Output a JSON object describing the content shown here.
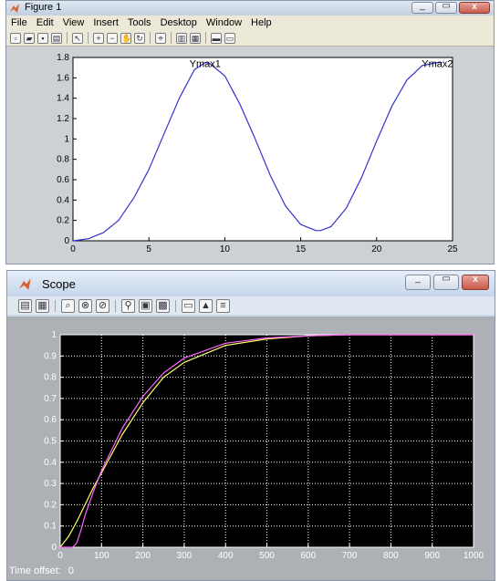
{
  "figure_window": {
    "title": "Figure 1",
    "menu": [
      "File",
      "Edit",
      "View",
      "Insert",
      "Tools",
      "Desktop",
      "Window",
      "Help"
    ],
    "toolbar_icons": [
      "new-file-icon",
      "open-icon",
      "save-icon",
      "print-icon",
      "pointer-icon",
      "zoom-in-icon",
      "zoom-out-icon",
      "pan-icon",
      "rotate-icon",
      "data-cursor-icon",
      "colorbar-icon",
      "legend-icon",
      "hide-tools-icon",
      "show-tools-icon"
    ]
  },
  "scope_window": {
    "title": "Scope",
    "toolbar_icons": [
      "print-icon",
      "parameters-icon",
      "zoom-icon",
      "zoom-x-icon",
      "zoom-y-icon",
      "autoscale-icon",
      "save-axes-icon",
      "restore-axes-icon",
      "floating-scope-icon",
      "lock-axes-icon",
      "signal-selector-icon"
    ],
    "time_offset_label": "Time offset:",
    "time_offset_value": "0"
  },
  "chart_data": [
    {
      "type": "line",
      "title": "",
      "xlabel": "",
      "ylabel": "",
      "xlim": [
        0,
        25
      ],
      "ylim": [
        0,
        1.8
      ],
      "xticks": [
        0,
        5,
        10,
        15,
        20,
        25
      ],
      "yticks": [
        0,
        0.2,
        0.4,
        0.6,
        0.8,
        1,
        1.2,
        1.4,
        1.6,
        1.8
      ],
      "ytick_labels": [
        "0",
        "0.2",
        "0.4",
        "0.6",
        "0.8",
        "1",
        "1.2",
        "1.4",
        "1.6",
        "1.8"
      ],
      "grid": false,
      "series": [
        {
          "color": "#3333cc",
          "x": [
            0,
            1,
            2,
            3,
            4,
            5,
            6,
            7,
            8,
            8.7,
            9,
            10,
            11,
            12,
            13,
            14,
            15,
            16,
            16.3,
            17,
            18,
            19,
            20,
            21,
            22,
            23,
            24,
            24.3
          ],
          "y": [
            0,
            0.02,
            0.08,
            0.2,
            0.42,
            0.7,
            1.05,
            1.4,
            1.68,
            1.75,
            1.74,
            1.62,
            1.34,
            1.0,
            0.64,
            0.34,
            0.16,
            0.1,
            0.1,
            0.14,
            0.32,
            0.62,
            0.98,
            1.32,
            1.58,
            1.72,
            1.75,
            1.75
          ]
        }
      ],
      "annotations": [
        {
          "text": "Ymax1",
          "x": 8.7,
          "y": 1.75
        },
        {
          "text": "Ymax2",
          "x": 24.0,
          "y": 1.75
        }
      ]
    },
    {
      "type": "line",
      "title": "",
      "xlabel": "",
      "ylabel": "",
      "xlim": [
        0,
        1000
      ],
      "ylim": [
        0,
        1
      ],
      "xticks": [
        0,
        100,
        200,
        300,
        400,
        500,
        600,
        700,
        800,
        900,
        1000
      ],
      "yticks": [
        0,
        0.1,
        0.2,
        0.3,
        0.4,
        0.5,
        0.6,
        0.7,
        0.8,
        0.9,
        1
      ],
      "grid": true,
      "series": [
        {
          "color": "#ffff66",
          "x": [
            0,
            20,
            40,
            60,
            80,
            100,
            150,
            200,
            250,
            300,
            400,
            500,
            600,
            700,
            800,
            1000
          ],
          "y": [
            0,
            0.05,
            0.12,
            0.2,
            0.28,
            0.35,
            0.53,
            0.68,
            0.8,
            0.87,
            0.95,
            0.98,
            0.995,
            1,
            1,
            1
          ]
        },
        {
          "color": "#ff66ff",
          "x": [
            0,
            30,
            40,
            50,
            60,
            80,
            100,
            150,
            200,
            250,
            300,
            400,
            500,
            600,
            700,
            800,
            1000
          ],
          "y": [
            0,
            0,
            0.02,
            0.08,
            0.15,
            0.26,
            0.36,
            0.56,
            0.71,
            0.82,
            0.89,
            0.96,
            0.985,
            0.995,
            1,
            1,
            1
          ]
        }
      ]
    }
  ]
}
